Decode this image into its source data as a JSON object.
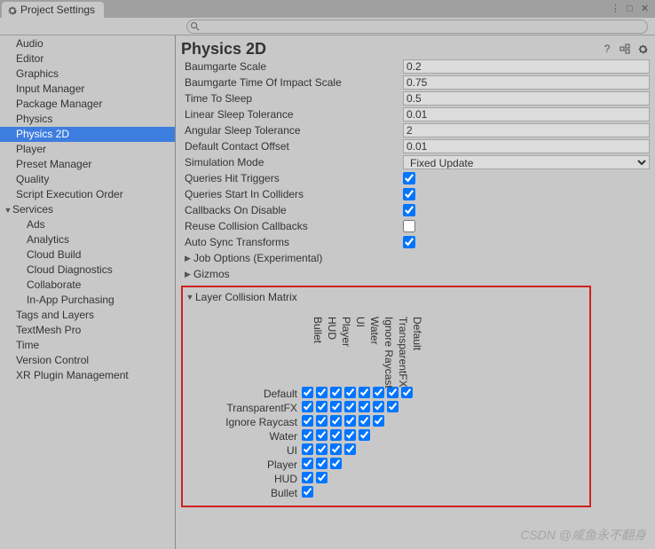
{
  "window": {
    "tab_title": "Project Settings",
    "search_placeholder": ""
  },
  "sidebar": {
    "items": [
      {
        "label": "Audio",
        "indent": false,
        "arrow": ""
      },
      {
        "label": "Editor",
        "indent": false,
        "arrow": ""
      },
      {
        "label": "Graphics",
        "indent": false,
        "arrow": ""
      },
      {
        "label": "Input Manager",
        "indent": false,
        "arrow": ""
      },
      {
        "label": "Package Manager",
        "indent": false,
        "arrow": ""
      },
      {
        "label": "Physics",
        "indent": false,
        "arrow": ""
      },
      {
        "label": "Physics 2D",
        "indent": false,
        "arrow": "",
        "selected": true
      },
      {
        "label": "Player",
        "indent": false,
        "arrow": ""
      },
      {
        "label": "Preset Manager",
        "indent": false,
        "arrow": ""
      },
      {
        "label": "Quality",
        "indent": false,
        "arrow": ""
      },
      {
        "label": "Script Execution Order",
        "indent": false,
        "arrow": ""
      },
      {
        "label": "Services",
        "indent": false,
        "arrow": "▼"
      },
      {
        "label": "Ads",
        "indent": true,
        "arrow": ""
      },
      {
        "label": "Analytics",
        "indent": true,
        "arrow": ""
      },
      {
        "label": "Cloud Build",
        "indent": true,
        "arrow": ""
      },
      {
        "label": "Cloud Diagnostics",
        "indent": true,
        "arrow": ""
      },
      {
        "label": "Collaborate",
        "indent": true,
        "arrow": ""
      },
      {
        "label": "In-App Purchasing",
        "indent": true,
        "arrow": ""
      },
      {
        "label": "Tags and Layers",
        "indent": false,
        "arrow": ""
      },
      {
        "label": "TextMesh Pro",
        "indent": false,
        "arrow": ""
      },
      {
        "label": "Time",
        "indent": false,
        "arrow": ""
      },
      {
        "label": "Version Control",
        "indent": false,
        "arrow": ""
      },
      {
        "label": "XR Plugin Management",
        "indent": false,
        "arrow": ""
      }
    ]
  },
  "content": {
    "title": "Physics 2D",
    "props_numeric": [
      {
        "label": "Baumgarte Scale",
        "value": "0.2"
      },
      {
        "label": "Baumgarte Time Of Impact Scale",
        "value": "0.75"
      },
      {
        "label": "Time To Sleep",
        "value": "0.5"
      },
      {
        "label": "Linear Sleep Tolerance",
        "value": "0.01"
      },
      {
        "label": "Angular Sleep Tolerance",
        "value": "2"
      },
      {
        "label": "Default Contact Offset",
        "value": "0.01"
      }
    ],
    "simulation_mode": {
      "label": "Simulation Mode",
      "value": "Fixed Update"
    },
    "props_checkbox": [
      {
        "label": "Queries Hit Triggers",
        "checked": true
      },
      {
        "label": "Queries Start In Colliders",
        "checked": true
      },
      {
        "label": "Callbacks On Disable",
        "checked": true
      },
      {
        "label": "Reuse Collision Callbacks",
        "checked": false
      },
      {
        "label": "Auto Sync Transforms",
        "checked": true
      }
    ],
    "foldouts": [
      {
        "arrow": "▶",
        "label": "Job Options (Experimental)"
      },
      {
        "arrow": "▶",
        "label": "Gizmos"
      }
    ],
    "matrix_title": {
      "arrow": "▼",
      "label": "Layer Collision Matrix"
    },
    "layers_cols_rev": [
      "Default",
      "TransparentFX",
      "Ignore Raycast",
      "Water",
      "UI",
      "Player",
      "HUD",
      "Bullet"
    ],
    "layers_rows": [
      "Default",
      "TransparentFX",
      "Ignore Raycast",
      "Water",
      "UI",
      "Player",
      "HUD",
      "Bullet"
    ]
  },
  "watermark": "CSDN @咸鱼永不翻身"
}
